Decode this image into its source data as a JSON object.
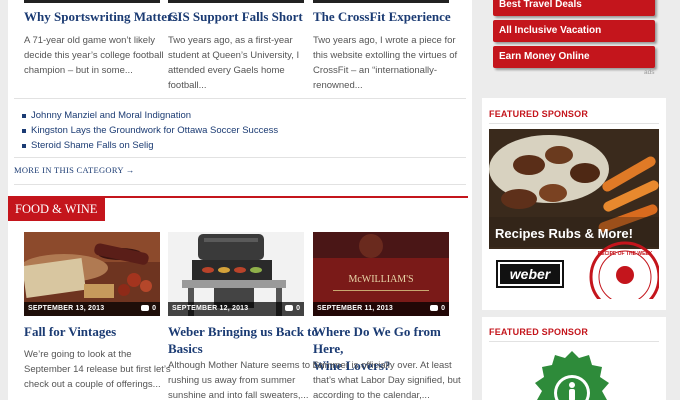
{
  "top_stories": [
    {
      "title": "Why Sportswriting Matters",
      "excerpt_lines": [
        "A 71-year old game won’t likely",
        "decide this year’s college football",
        "champion – but in some..."
      ]
    },
    {
      "title": "CIS Support Falls Short",
      "excerpt_lines": [
        "Two years ago, as a first-year",
        "student at Queen’s University, I",
        "attended every Gaels home",
        "football..."
      ]
    },
    {
      "title": "The CrossFit Experience",
      "excerpt_lines": [
        "Two years ago, I wrote a piece for",
        "this website extolling the virtues of",
        "CrossFit – an “internationally-",
        "renowned..."
      ]
    }
  ],
  "related_links": [
    "Johnny Manziel and Moral Indignation",
    "Kingston Lays the Groundwork for Ottawa Soccer Success",
    "Steroid Shame Falls on Selig"
  ],
  "more_link": "MORE IN THIS CATEGORY →",
  "category": {
    "label": "FOOD & WINE"
  },
  "food_posts": [
    {
      "date": "SEPTEMBER 13, 2013",
      "comments": "0",
      "title_lines": [
        "Fall for Vintages"
      ],
      "excerpt_lines": [
        "We’re going to look at the",
        "September 14 release but first let’s",
        "check out a couple of offerings..."
      ]
    },
    {
      "date": "SEPTEMBER 12, 2013",
      "comments": "0",
      "title_lines": [
        "Weber Bringing us Back to",
        "Basics"
      ],
      "excerpt_lines": [
        "Although Mother Nature seems to be",
        "rushing us away from summer",
        "sunshine and into fall sweaters,..."
      ]
    },
    {
      "date": "SEPTEMBER 11, 2013",
      "comments": "0",
      "title_lines": [
        "Where Do We Go from Here,",
        "Wine Lovers?"
      ],
      "excerpt_lines": [
        "Summer is officially over. At least",
        "that’s what Labor Day signified, but",
        "according to the calendar,..."
      ]
    }
  ],
  "sidebar": {
    "ad_buttons": [
      "Best Travel Deals",
      "All Inclusive Vacation",
      "Earn Money Online"
    ],
    "ads_label": "ads",
    "sponsor1": {
      "title": "FEATURED SPONSOR",
      "tagline": "Recipes Rubs & More!",
      "brand": "weber",
      "stamp": "RECIPE OF THE WEEK"
    },
    "sponsor2": {
      "title": "FEATURED SPONSOR"
    }
  },
  "thumb_text": {
    "wine_label": "McWILLIAM'S"
  },
  "colors": {
    "accent": "#c4151c",
    "link": "#1b3b73",
    "page_bg": "#ececec"
  }
}
